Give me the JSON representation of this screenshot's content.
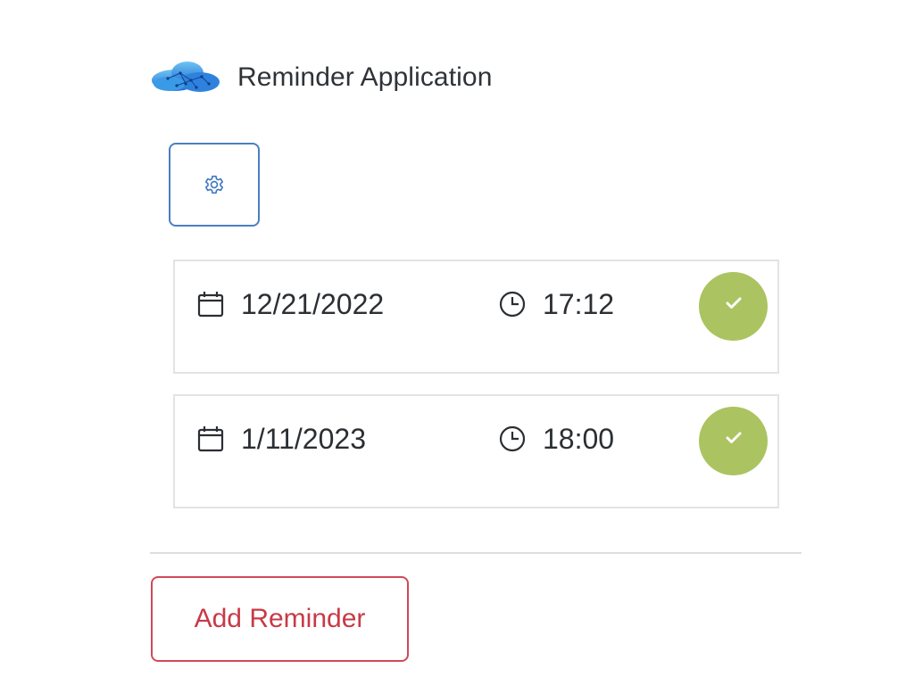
{
  "app": {
    "title": "Reminder Application",
    "logo_icon": "cloud-network-icon"
  },
  "toolbar": {
    "settings_icon": "gear-icon"
  },
  "reminders": [
    {
      "date": "12/21/2022",
      "time": "17:12",
      "date_icon": "calendar-icon",
      "time_icon": "clock-icon",
      "action_icon": "check-icon"
    },
    {
      "date": "1/11/2023",
      "time": "18:00",
      "date_icon": "calendar-icon",
      "time_icon": "clock-icon",
      "action_icon": "check-icon"
    }
  ],
  "actions": {
    "add_reminder_label": "Add Reminder"
  },
  "colors": {
    "primary_border": "#4a7fc1",
    "done_green": "#acc361",
    "danger": "#c83a47",
    "card_border": "#e1e3e5"
  }
}
